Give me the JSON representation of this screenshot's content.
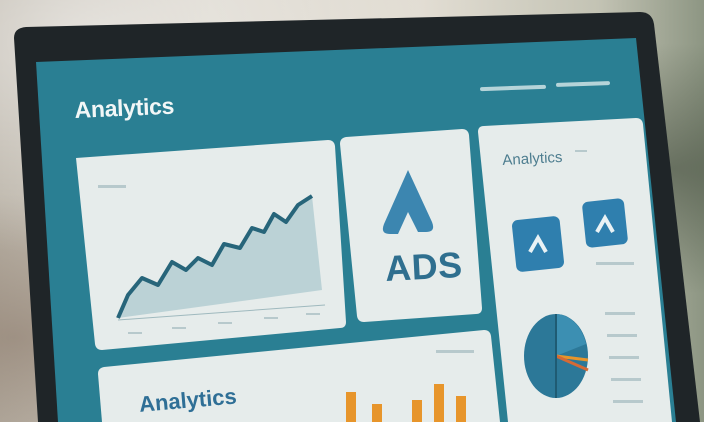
{
  "dashboard": {
    "title": "Analytics",
    "ads_label": "ADS",
    "side_card_title": "Analytics",
    "bottom_card_title": "Analytics"
  },
  "colors": {
    "screen": "#2a7f93",
    "card": "#e6eceb",
    "accent": "#2f6f8f",
    "bar_orange": "#e7952b"
  },
  "icons": [
    "ads-logo-icon",
    "app-icon",
    "pie-chart-icon",
    "line-chart-icon",
    "bar-chart-icon"
  ]
}
